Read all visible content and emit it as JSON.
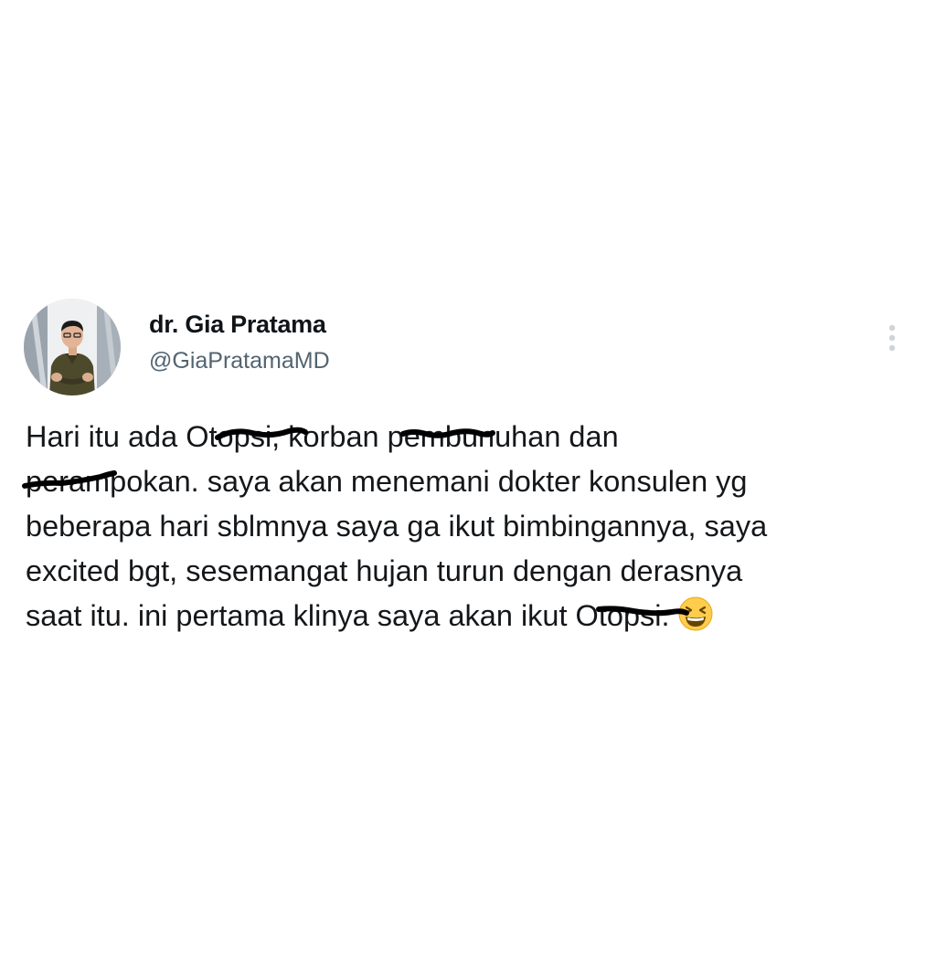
{
  "tweet": {
    "author": {
      "display_name": "dr. Gia Pratama",
      "handle": "@GiaPratamaMD",
      "avatar_icon": "profile-photo"
    },
    "more_icon": "more-vertical-icon",
    "body": {
      "line1_a": "Hari itu ada Ot",
      "line1_redacted1": "opsi",
      "line1_b": ", korban p",
      "line1_redacted2": "embunuha",
      "line1_c": "n dan",
      "line2_redacted": "perampo",
      "line2_a": "kan. saya akan menemani dokter konsulen yg",
      "line3": "beberapa hari sblmnya saya ga ikut bimbingannya, saya",
      "line4": "excited bgt, sesemangat hujan turun dengan derasnya",
      "line5_a": "saat itu. ini pertama klinya saya akan ikut O",
      "line5_redacted": "topsi",
      "line5_b": ".",
      "emoji": "grinning-squinting-face-emoji"
    },
    "colors": {
      "name": "#0f1419",
      "handle": "#536471",
      "text": "#14171a",
      "redaction": "#000000"
    }
  }
}
